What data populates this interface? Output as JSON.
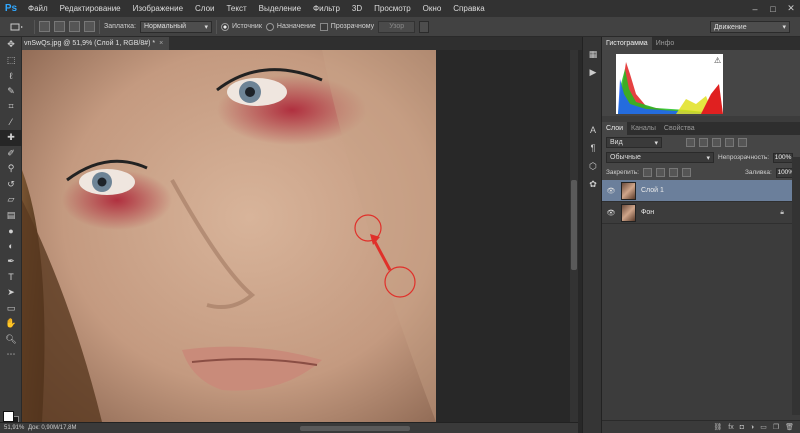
{
  "app": {
    "logo": "Ps"
  },
  "menu": [
    "Файл",
    "Редактирование",
    "Изображение",
    "Слои",
    "Текст",
    "Выделение",
    "Фильтр",
    "3D",
    "Просмотр",
    "Окно",
    "Справка"
  ],
  "window_controls": [
    "–",
    "□",
    "✕"
  ],
  "options_bar": {
    "patch_label": "Заплатка:",
    "patch_mode": "Нормальный",
    "source_label": "Источник",
    "destination_label": "Назначение",
    "transparent_label": "Прозрачному",
    "pattern_button": "Узор",
    "workspace": "Движение"
  },
  "document": {
    "tab_title": "vnSwQs.jpg @ 51,9% (Слой 1, RGB/8#) *",
    "close": "×"
  },
  "status": {
    "zoom": "51,91%",
    "doc_info": "Док: 0,90M/17,8M"
  },
  "histogram_panel": {
    "tabs": [
      "Гистограмма",
      "Инфо"
    ],
    "warning": "⚠"
  },
  "layers_panel": {
    "tabs": [
      "Слои",
      "Каналы",
      "Свойства"
    ],
    "filter_kind": "Вид",
    "blend_mode": "Обычные",
    "opacity_label": "Непрозрачность:",
    "opacity_value": "100%",
    "lock_label": "Закрепить:",
    "fill_label": "Заливка:",
    "fill_value": "100%",
    "layers": [
      {
        "name": "Слой 1",
        "selected": true,
        "locked": false
      },
      {
        "name": "Фон",
        "selected": false,
        "locked": true
      }
    ],
    "footer_icons": [
      "link-icon",
      "fx-icon",
      "mask-icon",
      "adjustment-icon",
      "folder-icon",
      "new-layer-icon",
      "trash-icon"
    ]
  },
  "colors": {
    "accent": "#31a8ff",
    "selected_layer": "#6b7f9b",
    "annotation": "#e0302a"
  }
}
